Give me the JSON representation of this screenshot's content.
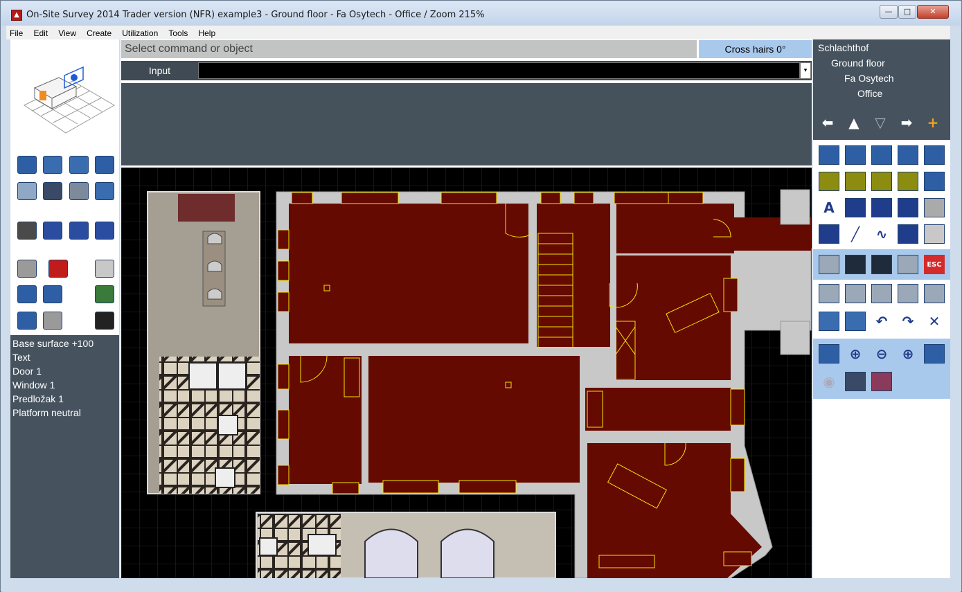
{
  "window": {
    "title": "On-Site Survey 2014 Trader version (NFR)   example3 - Ground floor - Fa Osytech - Office / Zoom 215%",
    "minimize_label": "—",
    "maximize_label": "□",
    "close_label": "✕"
  },
  "menu": [
    "File",
    "Edit",
    "View",
    "Create",
    "Utilization",
    "Tools",
    "Help"
  ],
  "command": {
    "prompt": "Select command or object",
    "crosshairs": "Cross hairs 0°",
    "input_label": "Input",
    "input_value": "",
    "dropdown_glyph": "▾"
  },
  "layers": [
    "Base surface +100",
    "Text",
    "Door 1",
    "Window 1",
    "Predložak 1",
    "Platform neutral"
  ],
  "tree": [
    "Schlachthof",
    "Ground floor",
    "Fa Osytech",
    "Office"
  ],
  "left_tools": [
    "zoom-out-3d-icon",
    "cube-front-icon",
    "cube-outline-icon",
    "zoom-in-3d-icon",
    "rotate-icon",
    "view-3d-icon",
    "cube-solid-icon",
    "zoom-fit-icon",
    "camera-icon",
    "audio-notes-icon",
    "video-icon",
    "timer-camera-icon",
    "eraser-icon",
    "laser-device-icon",
    "spray-icon",
    "swap-icon",
    "collapse-icon",
    "checklist-icon",
    "layer-list-icon",
    "traffic-light-icon",
    "save-icon"
  ],
  "right_tools": {
    "nav": [
      "arrow-left-icon",
      "arrow-up-icon",
      "arrow-down-icon",
      "arrow-right-icon",
      "add-level-icon"
    ],
    "create": [
      "add-room-icon",
      "add-surface-icon",
      "add-slanted-icon",
      "add-remove-icon",
      "add-roof-icon",
      "window-icon",
      "door-icon",
      "panel-icon",
      "basin-icon",
      "add-house-icon",
      "text-icon",
      "pen-ruler-icon",
      "pencil-icon",
      "stairs-icon",
      "building-icon",
      "dimension-icon",
      "line-icon",
      "curve-icon",
      "polyline-icon",
      "fill-icon"
    ],
    "measure": [
      "measure-gray-icon",
      "measure-yellow-icon",
      "measure-split-icon",
      "cancel-gray-icon",
      "esc-icon"
    ],
    "edit": [
      "import-icon",
      "export-icon",
      "copy-add-icon",
      "mirror-icon",
      "resize-icon",
      "move-icon",
      "transfer-icon",
      "undo-icon",
      "redo-icon",
      "delete-icon"
    ],
    "zoom": [
      "shrink-icon",
      "zoom-in-icon",
      "zoom-minus-icon",
      "zoom-plus-icon",
      "expand-icon",
      "eye-icon",
      "grid-spacing-icon",
      "layers-color-icon"
    ]
  },
  "esc_label": "ESC",
  "colors": {
    "wall": "#c8c8c8",
    "room": "#650a00",
    "fixture": "#f3e400",
    "panel_dark": "#46535e",
    "highlight": "#a9c9ec"
  }
}
